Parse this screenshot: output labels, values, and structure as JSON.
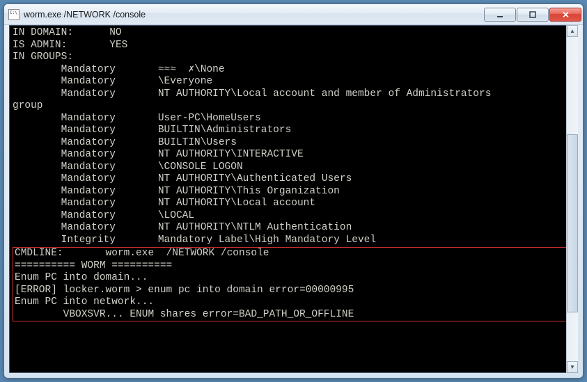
{
  "window": {
    "title": "worm.exe  /NETWORK /console"
  },
  "header": {
    "in_domain_label": "IN DOMAIN:",
    "in_domain_value": "NO",
    "is_admin_label": "IS ADMIN:",
    "is_admin_value": "YES",
    "in_groups_label": "IN GROUPS:"
  },
  "groups": [
    {
      "level": "Mandatory",
      "name": "≈≈≈  ✗\\None"
    },
    {
      "level": "Mandatory",
      "name": "\\Everyone"
    },
    {
      "level": "Mandatory",
      "name": "NT AUTHORITY\\Local account and member of Administrators"
    }
  ],
  "group_wrap": "group",
  "groups2": [
    {
      "level": "Mandatory",
      "name": "User-PC\\HomeUsers"
    },
    {
      "level": "Mandatory",
      "name": "BUILTIN\\Administrators"
    },
    {
      "level": "Mandatory",
      "name": "BUILTIN\\Users"
    },
    {
      "level": "Mandatory",
      "name": "NT AUTHORITY\\INTERACTIVE"
    },
    {
      "level": "Mandatory",
      "name": "\\CONSOLE LOGON"
    },
    {
      "level": "Mandatory",
      "name": "NT AUTHORITY\\Authenticated Users"
    },
    {
      "level": "Mandatory",
      "name": "NT AUTHORITY\\This Organization"
    },
    {
      "level": "Mandatory",
      "name": "NT AUTHORITY\\Local account"
    },
    {
      "level": "Mandatory",
      "name": "\\LOCAL"
    },
    {
      "level": "Mandatory",
      "name": "NT AUTHORITY\\NTLM Authentication"
    },
    {
      "level": "Integrity",
      "name": "Mandatory Label\\High Mandatory Level"
    }
  ],
  "highlight": {
    "cmdline_label": "CMDLINE:",
    "cmdline_value": "worm.exe  /NETWORK /console",
    "separator": "========== WORM ==========",
    "line3": "Enum PC into domain...",
    "line4": "[ERROR] locker.worm > enum pc into domain error=00000995",
    "line5": "Enum PC into network...",
    "line6_indent": "        ",
    "line6": "VBOXSVR... ENUM shares error=BAD_PATH_OR_OFFLINE"
  }
}
